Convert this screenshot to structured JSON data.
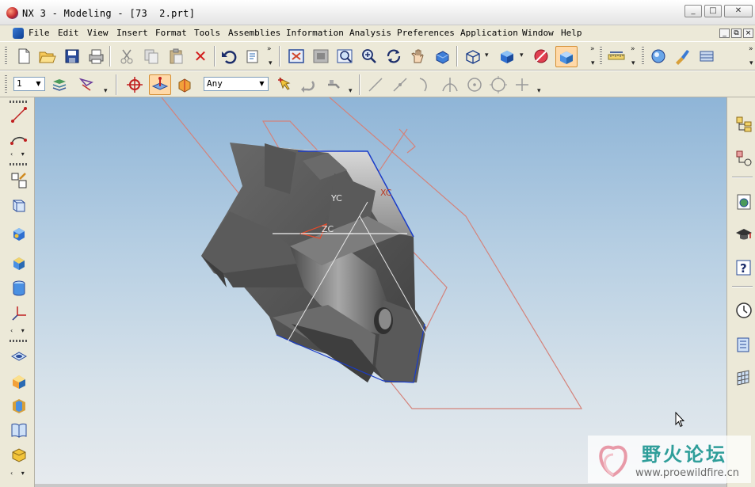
{
  "window": {
    "title": "NX 3 - Modeling - [73  2.prt]",
    "controls": {
      "minimize": "_",
      "maximize": "□",
      "close": "✕"
    }
  },
  "menubar": {
    "items": [
      "File",
      "Edit",
      "View",
      "Insert",
      "Format",
      "Tools",
      "Assemblies",
      "Information",
      "Analysis",
      "Preferences",
      "Application",
      "Window",
      "Help"
    ],
    "doc_controls": [
      "_",
      "⧉",
      "×"
    ]
  },
  "toolbar_standard": {
    "icons": [
      "new-file-icon",
      "open-folder-icon",
      "save-icon",
      "print-icon",
      "cut-icon",
      "copy-icon",
      "paste-icon",
      "delete-icon",
      "undo-icon",
      "properties-icon",
      "fit-view-icon",
      "zoom-window-icon",
      "zoom-box-icon",
      "zoom-icon",
      "rotate-icon",
      "pan-icon",
      "shaded-view-icon",
      "wireframe-icon",
      "solid-shaded-icon",
      "hide-icon",
      "iso-view-icon",
      "measure-icon",
      "render-icon",
      "paint-icon",
      "prepare-icon"
    ]
  },
  "toolbar_selection": {
    "layer_value": "1",
    "filter_value": "Any",
    "icons": [
      "layer-settings-icon",
      "selection-filter-icon",
      "crosshair-icon",
      "select-face-icon",
      "select-body-icon",
      "quick-pick-icon",
      "undo-selection-icon",
      "snap-options-icon",
      "line-icon",
      "line-endpoint-icon",
      "arc-icon",
      "intersection-icon",
      "circle-center-icon",
      "circle-icon",
      "point-icon"
    ]
  },
  "left_toolbar": {
    "icons": [
      "line-tool-icon",
      "arc-tool-icon",
      "sketch-icon",
      "extrude-icon",
      "block-icon",
      "cube-icon",
      "cylinder-icon",
      "datum-csys-icon",
      "hole-icon",
      "face-icon",
      "blend-icon",
      "book-icon",
      "edit-feature-icon"
    ]
  },
  "right_toolbar": {
    "icons": [
      "assembly-navigator-icon",
      "part-navigator-icon",
      "web-browser-icon",
      "training-icon",
      "help-icon",
      "history-icon",
      "system-materials-icon",
      "palette-icon"
    ]
  },
  "viewport": {
    "axis_labels": {
      "yc": "YC",
      "xc": "XC",
      "zc": "ZC"
    },
    "colors": {
      "datum_planes": "#d4827a",
      "edge_highlight": "#1a3cc8",
      "axis_label": "#b83a26",
      "background_top": "#8fb5d7",
      "background_bottom": "#e6eaee"
    }
  },
  "watermark": {
    "title": "野火论坛",
    "url": "www.proewildfire.cn"
  }
}
